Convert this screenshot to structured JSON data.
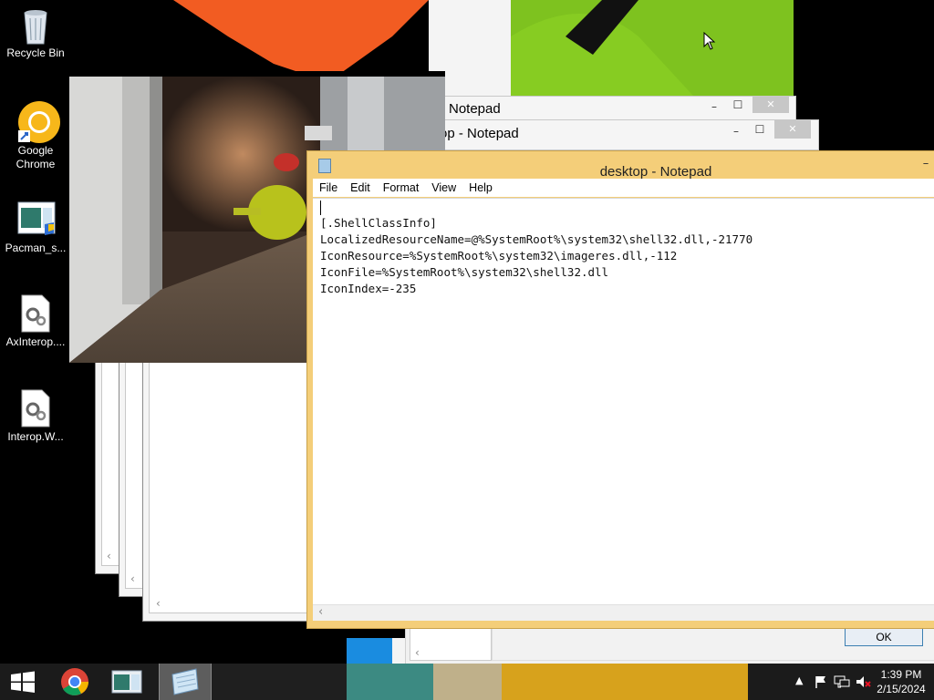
{
  "desktop": {
    "icons": [
      {
        "label": "Recycle Bin",
        "icon": "recycle-bin-icon"
      },
      {
        "label": "Google Chrome",
        "icon": "chrome-icon"
      },
      {
        "label": "Pacman_s...",
        "icon": "installer-icon"
      },
      {
        "label": "AxInterop....",
        "icon": "dll-file-icon"
      },
      {
        "label": "Interop.W...",
        "icon": "dll-file-icon"
      }
    ]
  },
  "background_windows": {
    "notepad_a_title": "Notepad",
    "notepad_b_title": "op - Notepad",
    "dialog_ok_label": "OK",
    "minimize_glyph": "–",
    "maximize_glyph": "☐",
    "close_glyph": "✕"
  },
  "notepad": {
    "title": "desktop - Notepad",
    "minimize_glyph": "–",
    "menu": {
      "file": "File",
      "edit": "Edit",
      "format": "Format",
      "view": "View",
      "help": "Help"
    },
    "content": "[.ShellClassInfo]\nLocalizedResourceName=@%SystemRoot%\\system32\\shell32.dll,-21770\nIconResource=%SystemRoot%\\system32\\imageres.dll,-112\nIconFile=%SystemRoot%\\system32\\shell32.dll\nIconIndex=-235",
    "scroll_left_glyph": "‹"
  },
  "taskbar": {
    "start_icon": "windows-logo-icon",
    "pinned": [
      "chrome-icon",
      "installer-icon",
      "notepad-icon"
    ],
    "tray": {
      "icons": [
        "show-hidden-icons-chevron",
        "action-center-flag-icon",
        "network-icon",
        "volume-muted-icon"
      ],
      "time": "1:39 PM",
      "date": "2/15/2024"
    }
  },
  "colors": {
    "notepad_frame": "#f4ce79",
    "wallpaper_orange": "#f25c22",
    "wallpaper_green": "#7ec21f",
    "taskbar_teal": "#3c8a82"
  }
}
